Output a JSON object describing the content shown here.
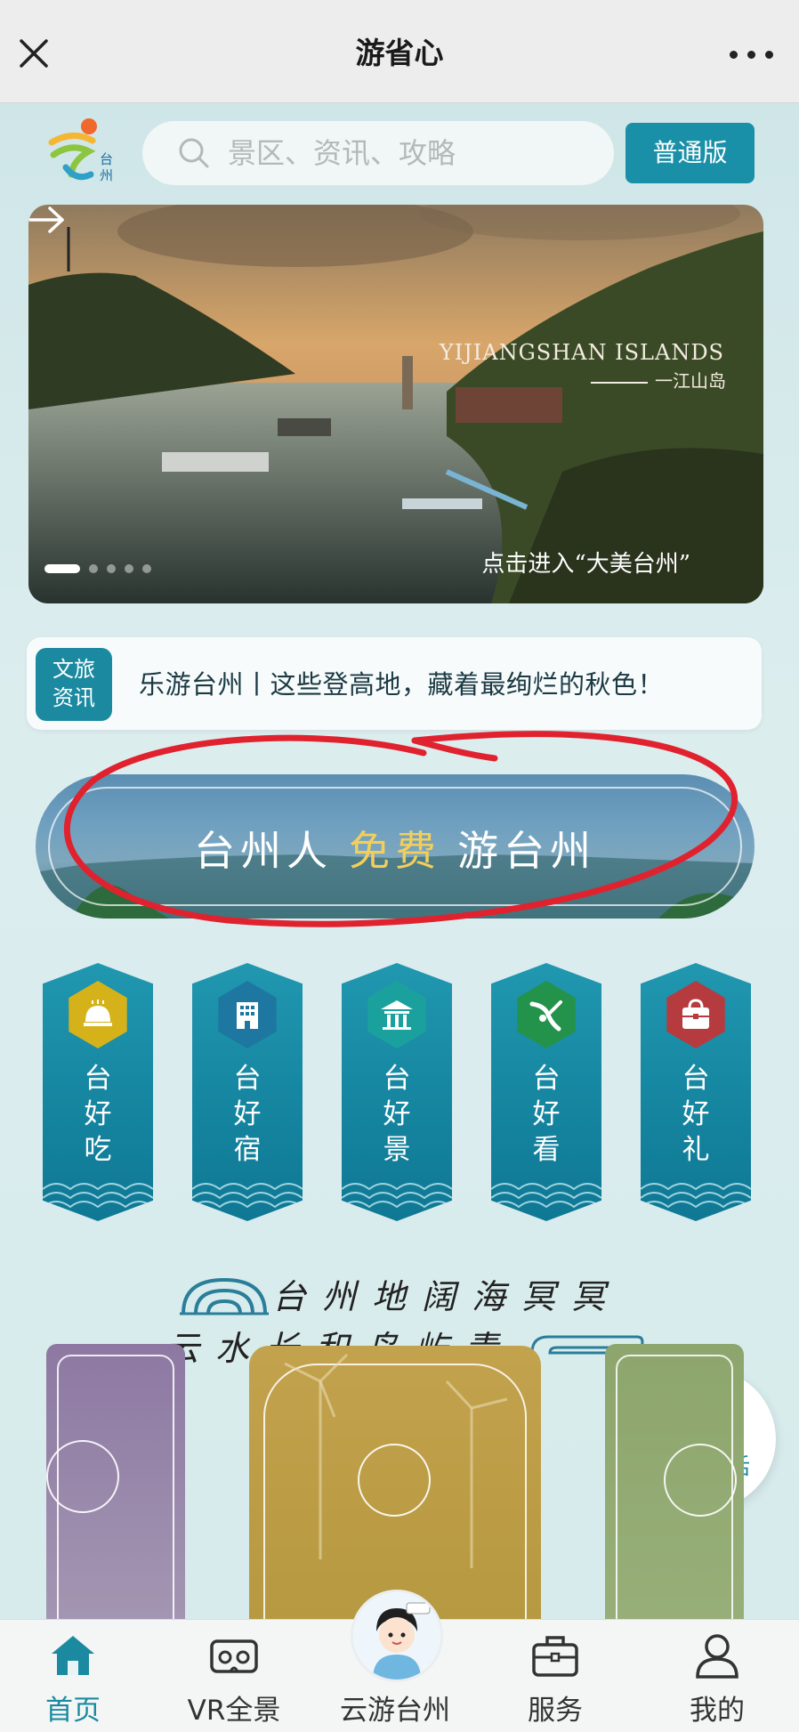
{
  "topbar": {
    "title": "游省心",
    "close_icon": "close-icon",
    "more_icon": "more-icon"
  },
  "header": {
    "logo_text": "台州",
    "search_placeholder": "景区、资讯、攻略",
    "version_button": "普通版"
  },
  "banner": {
    "title_en": "YIJIANGSHAN ISLANDS",
    "title_cn": "一江山岛",
    "cta": "点击进入“大美台州”",
    "page_count": 5,
    "active_page": 1
  },
  "news": {
    "badge_line1": "文旅",
    "badge_line2": "资讯",
    "headline": "乐游台州丨这些登高地，藏着最绚烂的秋色！"
  },
  "promo": {
    "text_before": "台州人",
    "text_highlight": "免费",
    "text_after": "游台州"
  },
  "categories": [
    {
      "chars": [
        "台",
        "好",
        "吃"
      ],
      "icon": "food-cloche-icon",
      "color": "#d5b21a"
    },
    {
      "chars": [
        "台",
        "好",
        "宿"
      ],
      "icon": "hotel-building-icon",
      "color": "#1d77a0"
    },
    {
      "chars": [
        "台",
        "好",
        "景"
      ],
      "icon": "pavilion-icon",
      "color": "#1aa19e"
    },
    {
      "chars": [
        "台",
        "好",
        "看"
      ],
      "icon": "performance-icon",
      "color": "#23924a"
    },
    {
      "chars": [
        "台",
        "好",
        "礼"
      ],
      "icon": "gift-bag-icon",
      "color": "#b53b3f"
    }
  ],
  "slogan": {
    "line1": "台州地阔海冥冥",
    "line2": "云水长和岛屿青"
  },
  "floating": {
    "phone_label": "景区电话",
    "phone_icon": "headset-icon"
  },
  "bottom_nav": [
    {
      "label": "首页",
      "icon": "home-icon",
      "active": true
    },
    {
      "label": "VR全景",
      "icon": "vr-headset-icon",
      "active": false
    },
    {
      "label": "云游台州",
      "icon": "mascot-avatar-icon",
      "active": false
    },
    {
      "label": "服务",
      "icon": "briefcase-icon",
      "active": false
    },
    {
      "label": "我的",
      "icon": "user-icon",
      "active": false
    }
  ],
  "colors": {
    "accent": "#1b8aa0",
    "highlight_yellow": "#f3cf59",
    "annotation_red": "#e0222f"
  }
}
